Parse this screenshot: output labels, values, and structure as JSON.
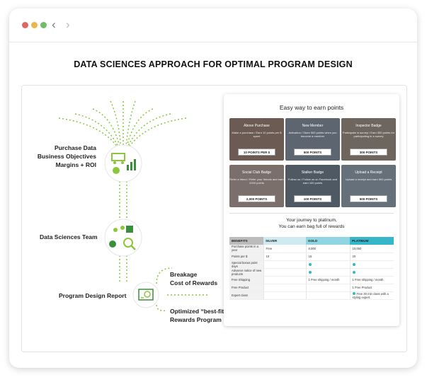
{
  "browser": {
    "back_icon": "chevron-left-icon",
    "forward_icon": "chevron-right-icon",
    "back_glyph": "‹",
    "forward_glyph": "›"
  },
  "heading": "DATA SCIENCES APPROACH FOR OPTIMAL PROGRAM DESIGN",
  "diagram": {
    "inputs": [
      "Purchase Data",
      "Business Objectives",
      "Margins + ROI"
    ],
    "team": "Data Sciences Team",
    "report": "Program Design Report",
    "outcome_1": [
      "Breakage",
      "Cost of Rewards"
    ],
    "outcome_2": [
      "Optimized “best-fit”",
      "Rewards Program"
    ],
    "icons": [
      "cart-chart-icon",
      "team-search-icon",
      "report-icon"
    ],
    "accent_color": "#8cc63f"
  },
  "earn": {
    "title": "Easy way to earn points",
    "tiles": [
      {
        "title": "Above Purchase",
        "desc": "Make a purchase / Earn 10 points per $ spent",
        "points": "10 POINTS PER $",
        "color": "#6b5b52"
      },
      {
        "title": "New Member",
        "desc": "Activation / Store 500 points when you become a member",
        "points": "500 POINTS",
        "color": "#5c6570"
      },
      {
        "title": "Inspector Badge",
        "desc": "Participate in survey / Earn 300 points for participating in a survey",
        "points": "300 POINTS",
        "color": "#6e655e"
      },
      {
        "title": "Social Club Badge",
        "desc": "Refer a friend / Refer your friends and earn 2000 points",
        "points": "2,000 POINTS",
        "color": "#7a6f6a"
      },
      {
        "title": "Stalker Badge",
        "desc": "Follow us / Follow us on Facebook and earn 100 points",
        "points": "100 POINTS",
        "color": "#4f5963"
      },
      {
        "title": "Upload a Receipt",
        "desc": "Upload a receipt and earn 500 points",
        "points": "500 POINTS",
        "color": "#66707a"
      }
    ]
  },
  "journey": {
    "line1": "Your journey to platinum,",
    "line2": "You can earn bag full of rewards"
  },
  "tiers": {
    "headers": [
      "BENEFITS",
      "SILVER",
      "GOLD",
      "PLATINUM"
    ],
    "header_colors": [
      "#bcbcbc",
      "#cfeaf0",
      "#8fd6e2",
      "#35b7c9"
    ],
    "rows": [
      {
        "label": "Purchase points in a year",
        "silver": "Free",
        "gold": "8,000",
        "platinum": "10,000"
      },
      {
        "label": "Points per $",
        "silver": "10",
        "gold": "15",
        "platinum": "20"
      },
      {
        "label": "Special bonus point days",
        "silver": "",
        "gold": "check",
        "platinum": "check"
      },
      {
        "label": "Advance notice of new products",
        "silver": "",
        "gold": "check",
        "platinum": "check"
      },
      {
        "label": "Free Shipping",
        "silver": "",
        "gold": "1 Free shipping / month",
        "platinum": "1 Free shipping / month"
      },
      {
        "label": "Free Product",
        "silver": "",
        "gold": "",
        "platinum": "1 Free Product"
      },
      {
        "label": "Expert class",
        "silver": "",
        "gold": "",
        "platinum": "Free 30 min class with a styling expert."
      }
    ]
  }
}
